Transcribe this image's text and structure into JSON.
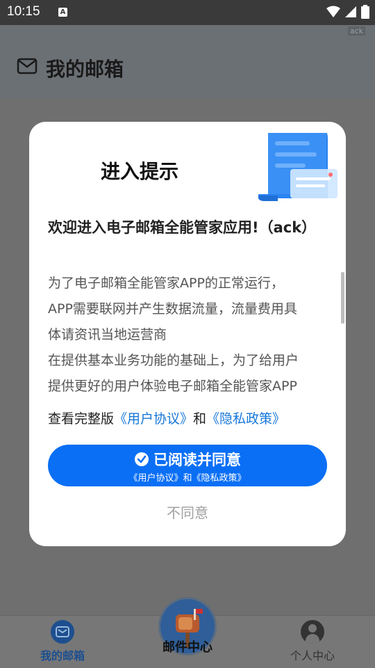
{
  "status_bar": {
    "time": "10:15",
    "notification_badge": "A",
    "icons": [
      "wifi-icon",
      "signal-icon",
      "battery-icon"
    ]
  },
  "header": {
    "title": "我的邮箱",
    "tag": "ack",
    "icon": "mail-icon"
  },
  "modal": {
    "title": "进入提示",
    "heading": "欢迎进入电子邮箱全能管家应用!（ack）",
    "body_lines": [
      "为了电子邮箱全能管家APP的正常运行，",
      "APP需要联网并产生数据流量，流量费用具",
      "体请资讯当地运营商",
      "在提供基本业务功能的基础上，为了给用户",
      "提供更好的用户体验电子邮箱全能管家APP"
    ],
    "links": {
      "prefix": "查看完整版",
      "user_agreement": "《用户协议》",
      "and": "和",
      "privacy_policy": "《隐私政策》"
    },
    "agree_button": {
      "label": "已阅读并同意",
      "sub_label": "《用户协议》和《隐私政策》"
    },
    "decline_button": "不同意"
  },
  "bottom_nav": {
    "items": [
      {
        "label": "我的邮箱",
        "icon": "mail-icon",
        "active": true
      },
      {
        "label": "邮件中心",
        "icon": "mailbox-icon",
        "active": false
      },
      {
        "label": "个人中心",
        "icon": "user-icon",
        "active": false
      }
    ]
  },
  "colors": {
    "accent": "#0a6ff5",
    "link": "#1677d9",
    "overlay": "#6f6f6f",
    "modal_bg": "#ffffff"
  }
}
